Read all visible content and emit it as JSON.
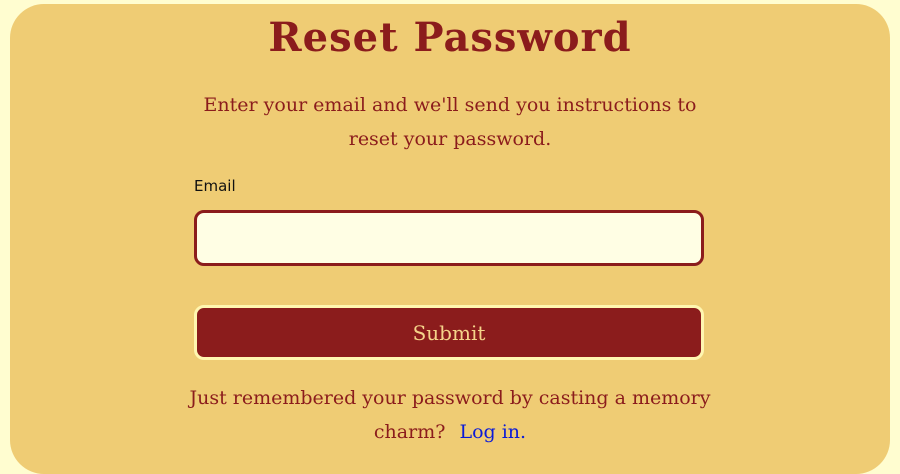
{
  "page": {
    "title": "Reset Password",
    "subtitle": "Enter your email and we'll send you instructions to reset your password."
  },
  "form": {
    "email_label": "Email",
    "email_value": "",
    "email_placeholder": "",
    "submit_label": "Submit"
  },
  "footer": {
    "text": "Just remembered your password by casting a memory charm?",
    "link_label": "Log in."
  },
  "colors": {
    "background": "#fffdd0",
    "card": "#efcc74",
    "accent": "#8b1c1c",
    "link": "#0a1ad8"
  }
}
